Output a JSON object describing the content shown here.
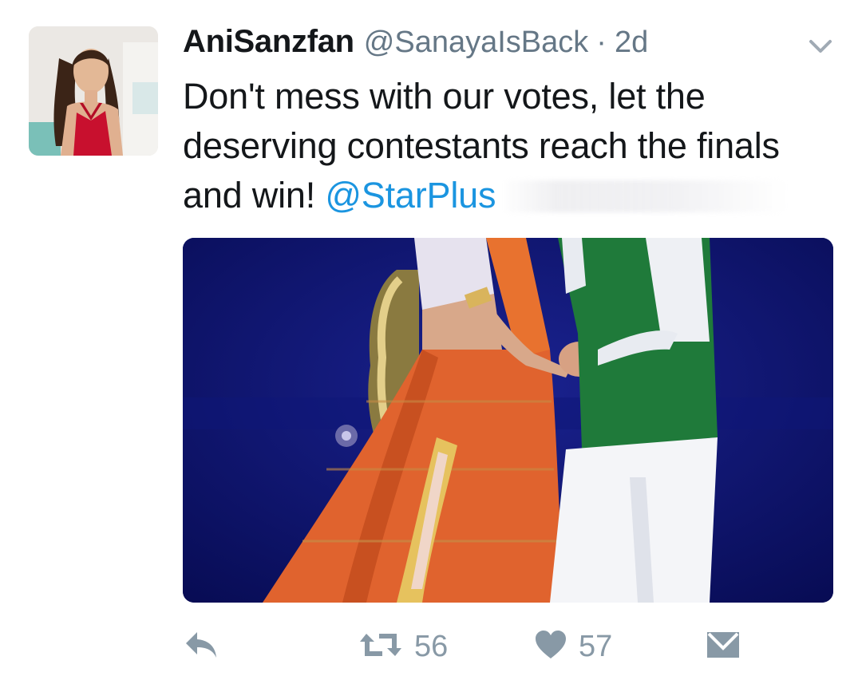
{
  "tweet": {
    "display_name": "AniSanzfan",
    "handle": "@SanayaIsBack",
    "separator": "·",
    "time": "2d",
    "text_before": "Don't mess with our votes, let the deserving contestants reach the finals and win! ",
    "mention": "@StarPlus"
  },
  "actions": {
    "reply_icon": "reply-icon",
    "retweet_icon": "retweet-icon",
    "retweet_count": "56",
    "like_icon": "heart-icon",
    "like_count": "57",
    "dm_icon": "direct-message-icon"
  },
  "colors": {
    "text": "#14171a",
    "secondary": "#657786",
    "link": "#1b95e0",
    "action_gray": "#8899a6"
  }
}
